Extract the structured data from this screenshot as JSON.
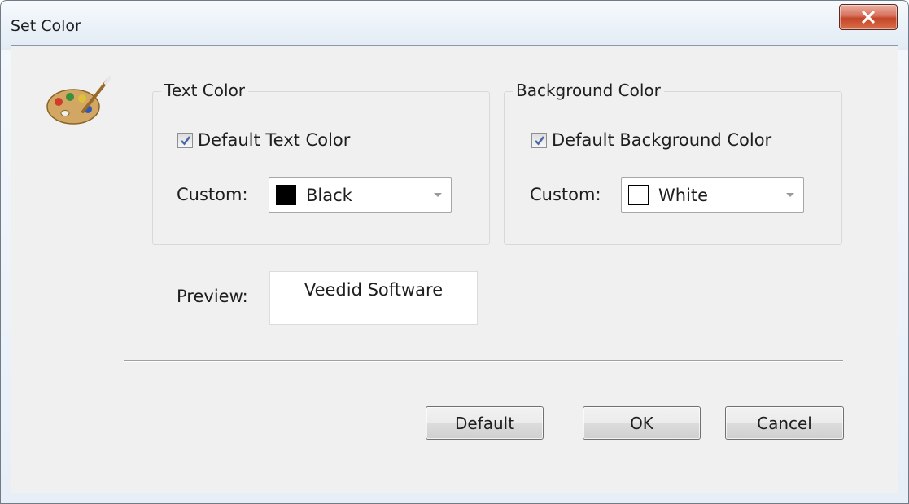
{
  "window": {
    "title": "Set Color"
  },
  "icons": {
    "app_icon": "palette-icon",
    "close": "close-icon",
    "checkmark": "checkmark-icon",
    "dropdown": "chevron-down-icon"
  },
  "text_color": {
    "group_title": "Text Color",
    "default_checkbox_label": "Default Text Color",
    "default_checked": true,
    "custom_label": "Custom:",
    "selected_value": "Black",
    "swatch_color": "#000000"
  },
  "background_color": {
    "group_title": "Background Color",
    "default_checkbox_label": "Default Background Color",
    "default_checked": true,
    "custom_label": "Custom:",
    "selected_value": "White",
    "swatch_color": "#ffffff"
  },
  "preview": {
    "label": "Preview:",
    "sample_text": "Veedid Software"
  },
  "buttons": {
    "default_label": "Default",
    "ok_label": "OK",
    "cancel_label": "Cancel"
  },
  "colors": {
    "close_button": "#c8492b",
    "dialog_background": "#f0f0f0",
    "checkmark": "#4b67a8"
  }
}
